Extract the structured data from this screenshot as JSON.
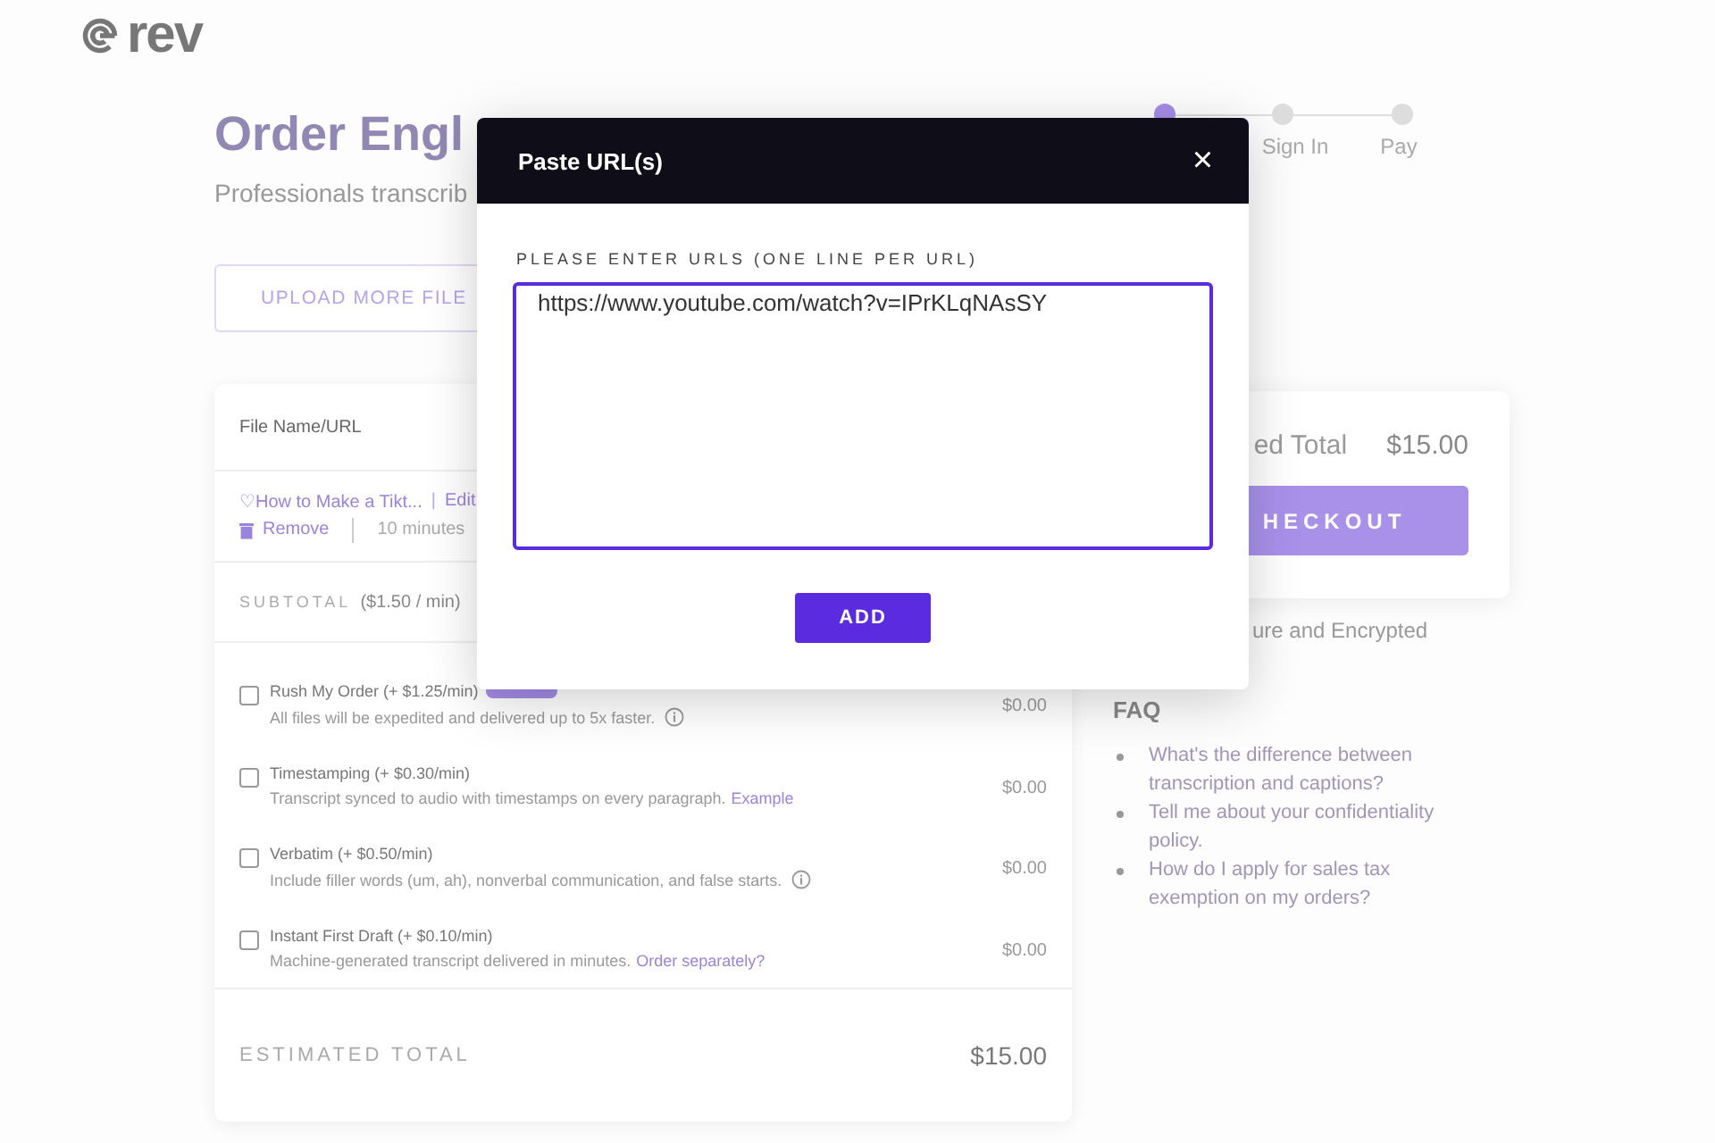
{
  "logo": {
    "text": "rev"
  },
  "stepper": [
    {
      "selected": true
    },
    {
      "label": "Sign In",
      "selected": false
    },
    {
      "label": "Pay",
      "selected": false
    }
  ],
  "page": {
    "title": "Order Engl",
    "subtitle": "Professionals transcrib",
    "upload_button": "UPLOAD MORE FILE"
  },
  "files": {
    "column": "File Name/URL",
    "file": {
      "name": "♡How to Make a Tikt...",
      "separator": "|",
      "edit": "Edit",
      "remove": "Remove",
      "duration": "10 minutes"
    },
    "subtotal_label": "SUBTOTAL",
    "subtotal_rate": "($1.50 / min)"
  },
  "options": [
    {
      "title": "Rush My Order (+ $1.25/min)",
      "badge": true,
      "description": "All files will be expedited and delivered up to 5x faster.",
      "info": true,
      "price": "$0.00",
      "checked": false
    },
    {
      "title": "Timestamping (+ $0.30/min)",
      "badge": false,
      "description": "Transcript synced to audio with timestamps on every paragraph.",
      "info": false,
      "link": "Example",
      "price": "$0.00",
      "checked": false
    },
    {
      "title": "Verbatim (+ $0.50/min)",
      "badge": false,
      "description": "Include filler words (um, ah), nonverbal communication, and false starts.",
      "info": true,
      "price": "$0.00",
      "checked": false
    },
    {
      "title": "Instant First Draft (+ $0.10/min)",
      "badge": false,
      "description": "Machine-generated transcript delivered in minutes.",
      "info": false,
      "link": "Order separately?",
      "price": "$0.00",
      "checked": false
    }
  ],
  "estimated_total": {
    "label": "ESTIMATED TOTAL",
    "value": "$15.00"
  },
  "summary": {
    "label": "ed Total",
    "value": "$15.00",
    "checkout": "HECKOUT",
    "secure": "ure and Encrypted"
  },
  "faq": {
    "title": "FAQ",
    "items": [
      "What's the difference between transcription and captions?",
      "Tell me about your confidentiality policy.",
      "How do I apply for sales tax exemption on my orders?"
    ]
  },
  "modal": {
    "title": "Paste URL(s)",
    "close": "×",
    "label": "PLEASE ENTER URLS (ONE LINE PER URL)",
    "value": "https://www.youtube.com/watch?v=IPrKLqNAsSY",
    "button": "ADD"
  }
}
